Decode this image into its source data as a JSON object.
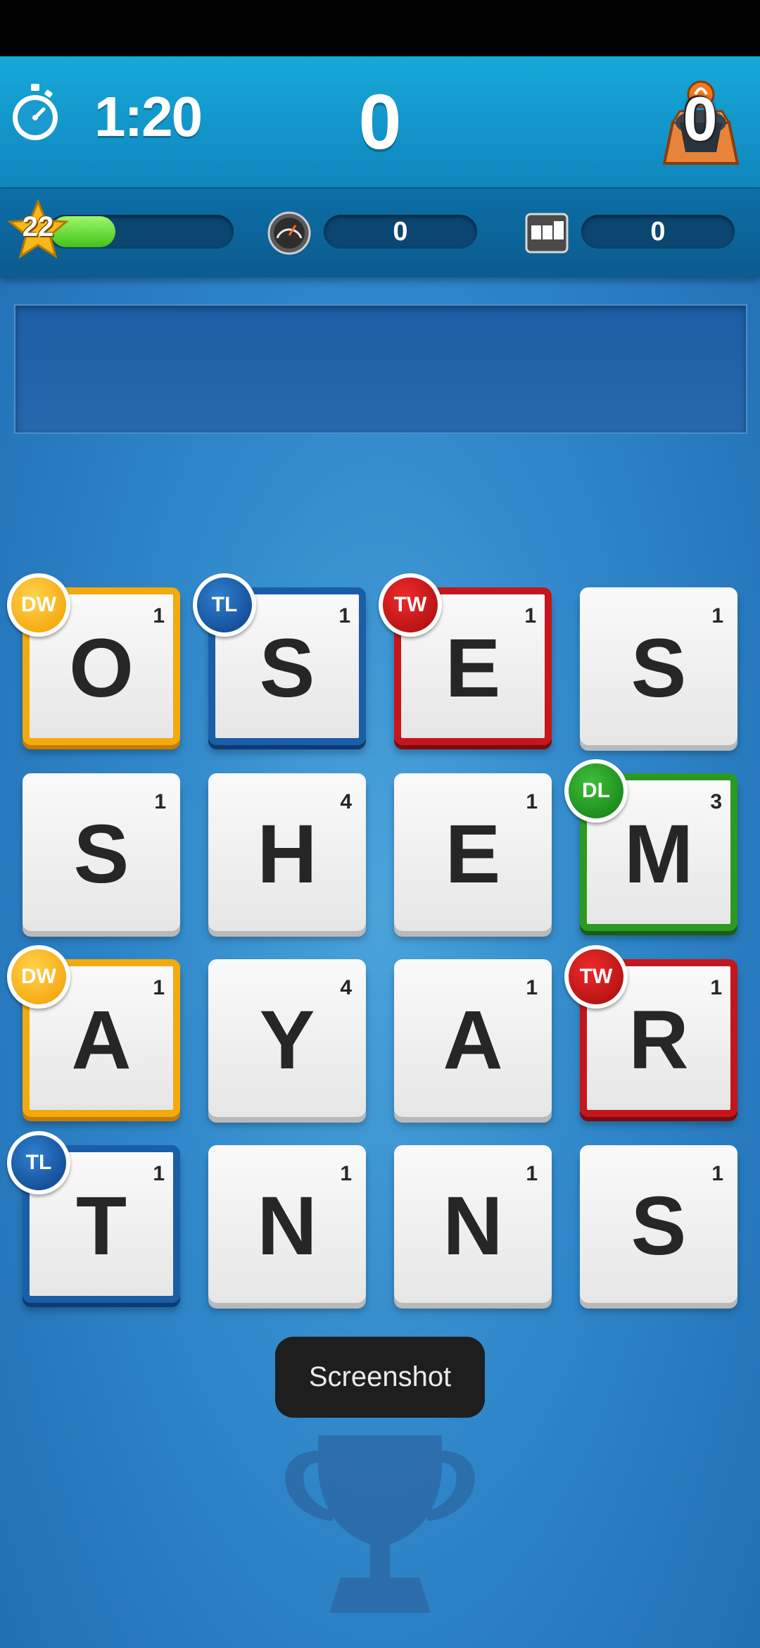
{
  "header": {
    "timer": "1:20",
    "score": "0",
    "chest_count": "0"
  },
  "stats": {
    "level": "22",
    "xp_progress": 0.25,
    "speed_value": "0",
    "counter_value": "0"
  },
  "board": {
    "tiles": [
      {
        "letter": "O",
        "points": "1",
        "bonus": "DW"
      },
      {
        "letter": "S",
        "points": "1",
        "bonus": "TL"
      },
      {
        "letter": "E",
        "points": "1",
        "bonus": "TW"
      },
      {
        "letter": "S",
        "points": "1",
        "bonus": ""
      },
      {
        "letter": "S",
        "points": "1",
        "bonus": ""
      },
      {
        "letter": "H",
        "points": "4",
        "bonus": ""
      },
      {
        "letter": "E",
        "points": "1",
        "bonus": ""
      },
      {
        "letter": "M",
        "points": "3",
        "bonus": "DL"
      },
      {
        "letter": "A",
        "points": "1",
        "bonus": "DW"
      },
      {
        "letter": "Y",
        "points": "4",
        "bonus": ""
      },
      {
        "letter": "A",
        "points": "1",
        "bonus": ""
      },
      {
        "letter": "R",
        "points": "1",
        "bonus": "TW"
      },
      {
        "letter": "T",
        "points": "1",
        "bonus": "TL"
      },
      {
        "letter": "N",
        "points": "1",
        "bonus": ""
      },
      {
        "letter": "N",
        "points": "1",
        "bonus": ""
      },
      {
        "letter": "S",
        "points": "1",
        "bonus": ""
      }
    ]
  },
  "toast": "Screenshot",
  "icons": {
    "timer": "stopwatch-icon",
    "chest": "treasure-chest-icon",
    "level": "star-icon",
    "speed": "speedometer-icon",
    "counter": "odometer-icon",
    "trophy": "trophy-icon"
  },
  "colors": {
    "DW": "#f4a90c",
    "TL": "#1a5ea8",
    "TW": "#c4161c",
    "DL": "#2b9a22",
    "xp_fill": "#44c218",
    "background": "#2f86c9"
  }
}
